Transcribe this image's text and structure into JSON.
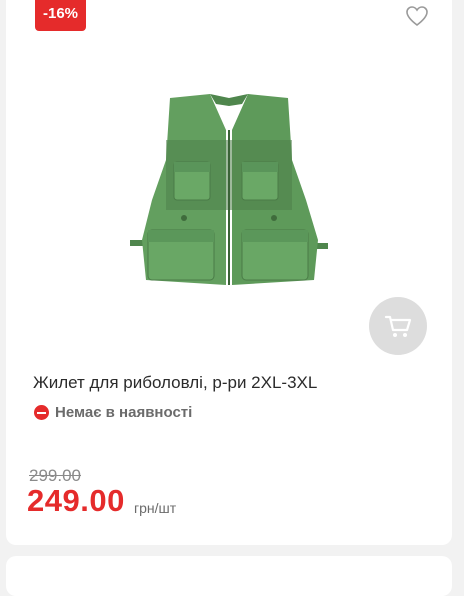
{
  "product": {
    "discount_badge": "-16%",
    "title": "Жилет для риболовлі, р-ри 2XL-3XL",
    "stock_status": "Немає в наявності",
    "old_price": "299.00",
    "price": "249.00",
    "unit": "грн/шт",
    "image_alt_icon": "vest-image"
  },
  "icons": {
    "wishlist": "heart-icon",
    "cart": "cart-icon",
    "stock": "minus-circle-icon"
  },
  "colors": {
    "accent": "#e52b2b",
    "cart_button_bg": "#dddddd",
    "vest_green": "#5f9a5c"
  }
}
